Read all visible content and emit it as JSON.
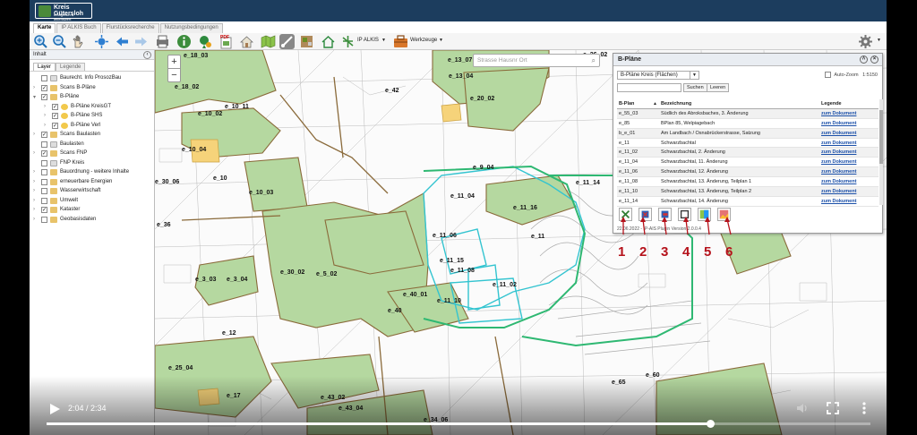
{
  "header": {
    "logo_title": "Kreis Gütersloh",
    "logo_subtitle": "erfolgreich & lebenswert"
  },
  "tabs": [
    "Karte",
    "IP ALKIS Buch",
    "Flurstücksrecherche",
    "Nutzungsbedingungen"
  ],
  "toolbar": {
    "alkis_label": "IP ALKIS",
    "werkzeuge_label": "Werkzeuge"
  },
  "sidebar": {
    "title": "Inhalt",
    "tabs": [
      "Layer",
      "Legende"
    ],
    "layers": [
      {
        "label": "Baurecht. Info ProsozBau",
        "indent": 0,
        "arrow": false,
        "checked": false,
        "icon": "grid"
      },
      {
        "label": "Scans B-Pläne",
        "indent": 0,
        "arrow": true,
        "checked": true,
        "icon": "folder"
      },
      {
        "label": "B-Pläne",
        "indent": 0,
        "arrow": true,
        "checked": true,
        "icon": "folder",
        "expanded": true
      },
      {
        "label": "B-Pläne KreisGT",
        "indent": 1,
        "arrow": true,
        "checked": true,
        "icon": "yellow"
      },
      {
        "label": "B-Pläne SHS",
        "indent": 1,
        "arrow": true,
        "checked": true,
        "icon": "yellow"
      },
      {
        "label": "B-Pläne Verl",
        "indent": 1,
        "arrow": true,
        "checked": true,
        "icon": "yellow"
      },
      {
        "label": "Scans Baulasten",
        "indent": 0,
        "arrow": true,
        "checked": true,
        "icon": "folder"
      },
      {
        "label": "Baulasten",
        "indent": 0,
        "arrow": false,
        "checked": false,
        "icon": "grid"
      },
      {
        "label": "Scans FNP",
        "indent": 0,
        "arrow": true,
        "checked": true,
        "icon": "folder"
      },
      {
        "label": "FNP Kreis",
        "indent": 0,
        "arrow": false,
        "checked": false,
        "icon": "grid"
      },
      {
        "label": "Bauordnung - weitere Inhalte",
        "indent": 0,
        "arrow": true,
        "checked": false,
        "icon": "folder"
      },
      {
        "label": "erneuerbare Energien",
        "indent": 0,
        "arrow": true,
        "checked": false,
        "icon": "folder"
      },
      {
        "label": "Wasserwirtschaft",
        "indent": 0,
        "arrow": true,
        "checked": false,
        "icon": "folder"
      },
      {
        "label": "Umwelt",
        "indent": 0,
        "arrow": true,
        "checked": false,
        "icon": "folder"
      },
      {
        "label": "Kataster",
        "indent": 0,
        "arrow": true,
        "checked": true,
        "icon": "folder"
      },
      {
        "label": "Geobasisdaten",
        "indent": 0,
        "arrow": true,
        "checked": false,
        "icon": "folder"
      }
    ]
  },
  "map": {
    "search_placeholder": "Strasse  Hausnr  Ort",
    "labels": [
      "e_18_03",
      "e_18_02",
      "e_10_02",
      "e_10_11",
      "e_42",
      "e_13_07",
      "e_26_02",
      "e_13_04",
      "e_20_02",
      "e_10_04",
      "e_10",
      "e_30_06",
      "e_10_03",
      "e_9_04",
      "e_11_04",
      "e_11_14",
      "e_11_16",
      "e_11_06",
      "e_11",
      "e_36",
      "e_30_02",
      "e_5_02",
      "e_3_03",
      "e_3_04",
      "e_11_15",
      "e_11_08",
      "e_11_02",
      "e_40_01",
      "e_11_10",
      "e_40",
      "e_12",
      "e_25_04",
      "e_17",
      "e_43_02",
      "e_43_04",
      "e_60",
      "e_65",
      "e_34_06"
    ]
  },
  "panel": {
    "title": "B-Pläne",
    "select_value": "B-Pläne Kreis (Flächen)",
    "autozoom_label": "Auto-Zoom",
    "autozoom_scale": "1:5150",
    "search_button": "Suchen",
    "clear_button": "Leeren",
    "columns": [
      "B-Plan",
      "Bezeichnung",
      "Legende"
    ],
    "rows": [
      [
        "e_55_03",
        "Südlich des Abroksbaches, 3. Änderung",
        "zum Dokument"
      ],
      [
        "e_85",
        "BPlan 85, Welpiagebach",
        "zum Dokument"
      ],
      [
        "b_e_01",
        "Am Landbach / Osnabrückerstrasse, Satzung",
        "zum Dokument"
      ],
      [
        "e_11",
        "Schwarzbachtal",
        "zum Dokument"
      ],
      [
        "e_11_02",
        "Schwarzbachtal, 2. Änderung",
        "zum Dokument"
      ],
      [
        "e_11_04",
        "Schwarzbachtal, 11. Änderung",
        "zum Dokument"
      ],
      [
        "e_11_06",
        "Schwarzbachtal, 12. Änderung",
        "zum Dokument"
      ],
      [
        "e_11_08",
        "Schwarzbachtal, 13. Änderung, Teilplan 1",
        "zum Dokument"
      ],
      [
        "e_11_10",
        "Schwarzbachtal, 13. Änderung, Teilplan 2",
        "zum Dokument"
      ],
      [
        "e_11_14",
        "Schwarzbachtal, 14. Änderung",
        "zum Dokument"
      ]
    ],
    "footer": "22.06.2022 - IP-AIS Plugin Version 2.0.0.4",
    "tool_numbers": [
      "1",
      "2",
      "3",
      "4",
      "5",
      "6"
    ]
  },
  "video": {
    "time": "2:04 / 2:34",
    "progress": 0.805
  },
  "colors": {
    "header": "#1c3d5e",
    "plan_fill": "#b5d8a0",
    "plan_border": "#8a6a3a",
    "cyan": "#33c4d0",
    "highlight_red": "#b5121b"
  }
}
